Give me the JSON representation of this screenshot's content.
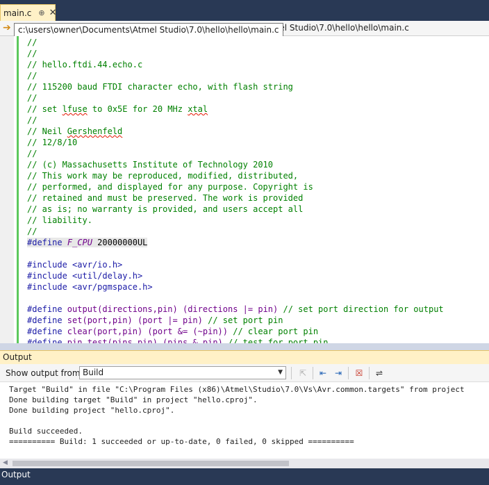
{
  "doc_tab": {
    "label": "main.c",
    "pin": "⊕",
    "close": "✕"
  },
  "navbar": {
    "path_partial": "Atmel Studio\\7.0\\hello\\hello\\main.c",
    "tooltip": "c:\\users\\owner\\Documents\\Atmel Studio\\7.0\\hello\\hello\\main.c"
  },
  "code": {
    "l1": "//",
    "l2": "//",
    "l3": "// hello.ftdi.44.echo.c",
    "l4": "//",
    "l5": "// 115200 baud FTDI character echo, with flash string",
    "l6": "//",
    "l7a": "// set ",
    "l7b": "lfuse",
    "l7c": " to 0x5E for 20 MHz ",
    "l7d": "xtal",
    "l8": "//",
    "l9a": "// Neil ",
    "l9b": "Gershenfeld",
    "l10": "// 12/8/10",
    "l11": "//",
    "l12": "// (c) Massachusetts Institute of Technology 2010",
    "l13": "// This work may be reproduced, modified, distributed,",
    "l14": "// performed, and displayed for any purpose. Copyright is",
    "l15": "// retained and must be preserved. The work is provided",
    "l16": "// as is; no warranty is provided, and users accept all",
    "l17": "// liability.",
    "l18": "//",
    "l19a": "#define",
    "l19b": "F_CPU",
    "l19c": " 20000000UL",
    "l21": "#include <avr/io.h>",
    "l22": "#include <util/delay.h>",
    "l23": "#include <avr/pgmspace.h>",
    "l25a": "#define",
    "l25b": " output(directions,pin) (directions |= pin) ",
    "l25c": "// set port direction for output",
    "l26a": "#define",
    "l26b": " set(port,pin) (port |= pin) ",
    "l26c": "// set port pin",
    "l27a": "#define",
    "l27b": " clear(port,pin) (port &= (~pin)) ",
    "l27c": "// clear port pin",
    "l28a": "#define",
    "l28b": " pin_test(pins,pin) (pins & pin) ",
    "l28c": "// test for port pin"
  },
  "output": {
    "title": "Output",
    "show_from_label": "Show output from:",
    "source": "Build",
    "lines": [
      "Target \"Build\" in file \"C:\\Program Files (x86)\\Atmel\\Studio\\7.0\\Vs\\Avr.common.targets\" from project",
      "Done building target \"Build\" in project \"hello.cproj\".",
      "Done building project \"hello.cproj\".",
      "",
      "Build succeeded.",
      "========== Build: 1 succeeded or up-to-date, 0 failed, 0 skipped =========="
    ]
  },
  "bottom_tab": "Output"
}
